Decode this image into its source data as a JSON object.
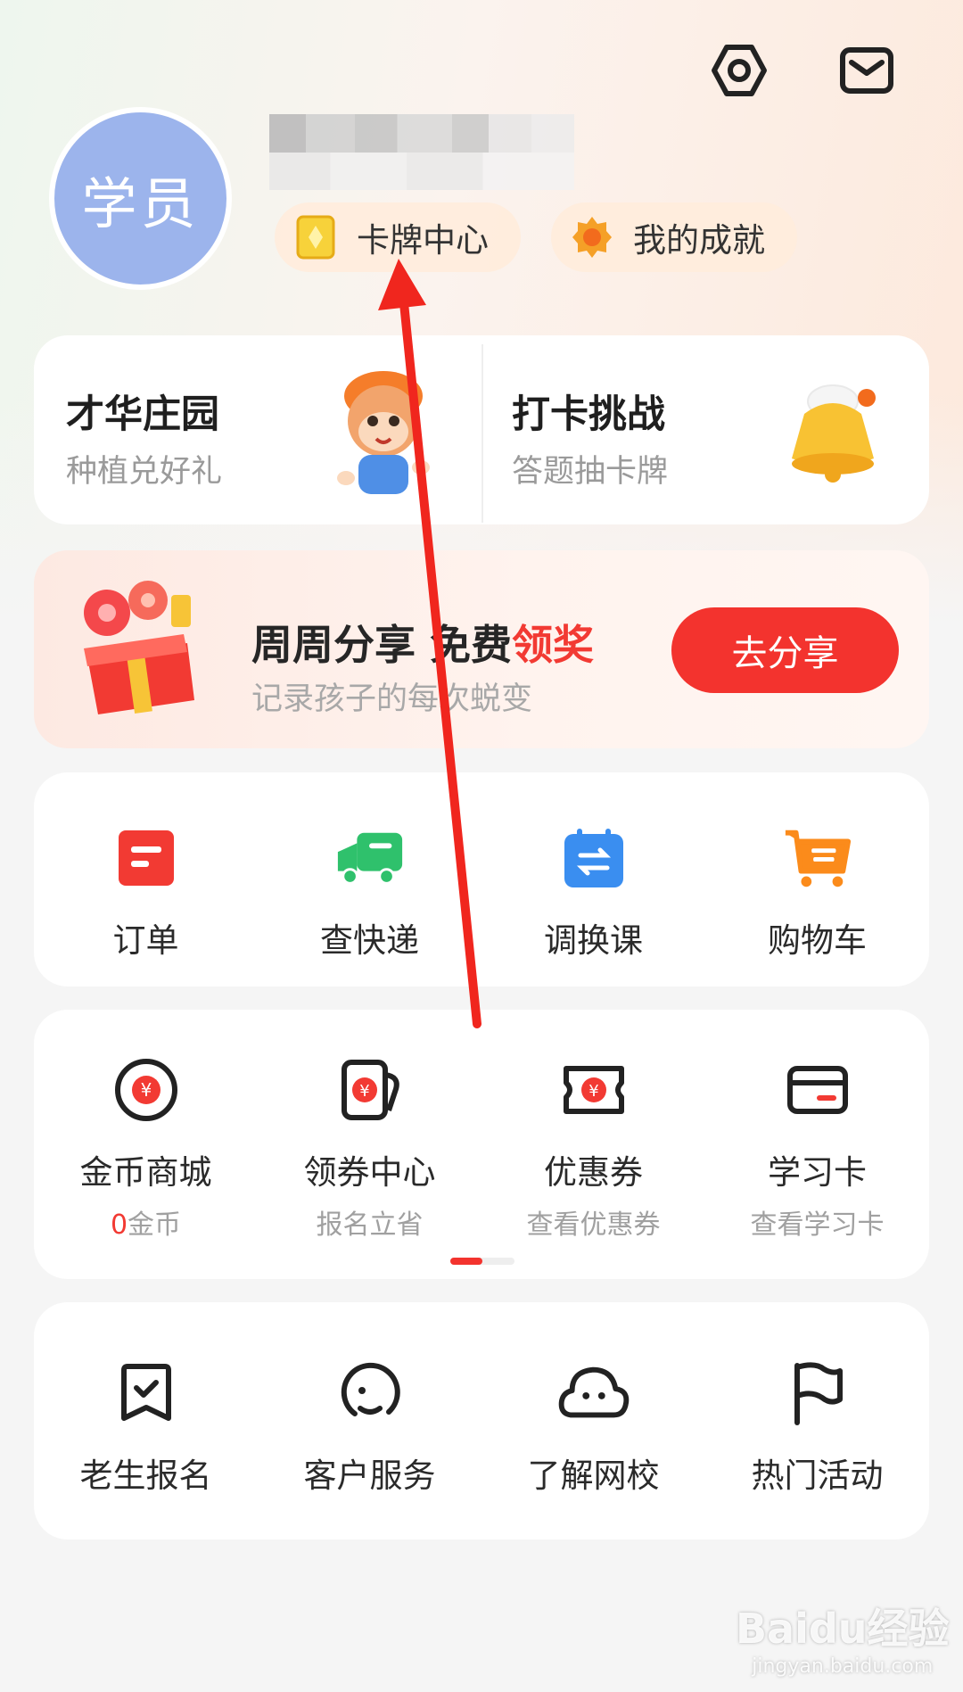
{
  "profile": {
    "avatar_text": "学员",
    "card_center_label": "卡牌中心",
    "achievements_label": "我的成就"
  },
  "features": {
    "left": {
      "title": "才华庄园",
      "subtitle": "种植兑好礼"
    },
    "right": {
      "title": "打卡挑战",
      "subtitle": "答题抽卡牌"
    }
  },
  "share": {
    "title_prefix": "周周分享 免费",
    "title_highlight": "领奖",
    "subtitle": "记录孩子的每次蜕变",
    "button_label": "去分享"
  },
  "quick_actions": [
    {
      "label": "订单",
      "icon": "order-icon"
    },
    {
      "label": "查快递",
      "icon": "delivery-truck-icon"
    },
    {
      "label": "调换课",
      "icon": "swap-class-icon"
    },
    {
      "label": "购物车",
      "icon": "shopping-cart-icon"
    }
  ],
  "wallet": {
    "items": [
      {
        "label": "金币商城",
        "sub_num": "0",
        "sub": "金币",
        "icon": "coin-mall-icon"
      },
      {
        "label": "领券中心",
        "sub": "报名立省",
        "icon": "coupon-center-icon"
      },
      {
        "label": "优惠券",
        "sub": "查看优惠券",
        "icon": "coupon-icon"
      },
      {
        "label": "学习卡",
        "sub": "查看学习卡",
        "icon": "study-card-icon"
      }
    ],
    "page_indicator": "1/2"
  },
  "services": [
    {
      "label": "老生报名",
      "icon": "re-enroll-icon"
    },
    {
      "label": "客户服务",
      "icon": "customer-service-icon"
    },
    {
      "label": "了解网校",
      "icon": "about-school-icon"
    },
    {
      "label": "热门活动",
      "icon": "flag-icon"
    }
  ],
  "watermark": {
    "brand": "Baidu经验",
    "url": "jingyan.baidu.com"
  },
  "colors": {
    "accent": "#f3332e",
    "avatar": "#9cb4ec"
  }
}
